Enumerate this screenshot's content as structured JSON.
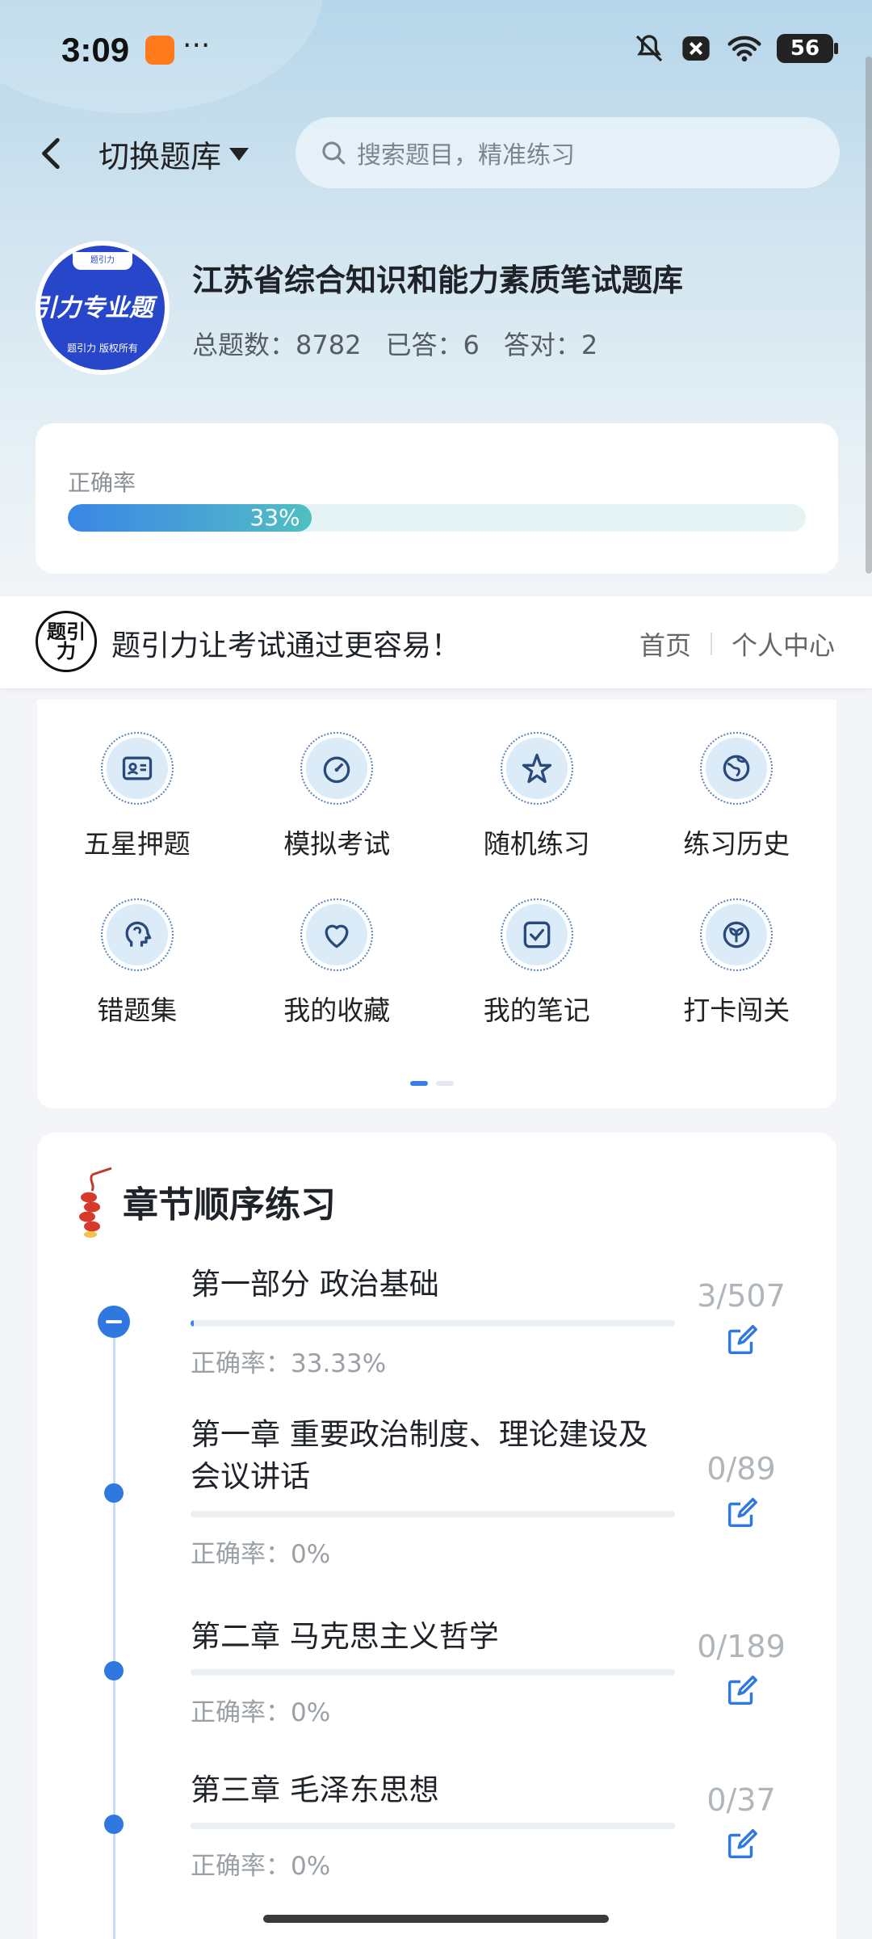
{
  "status_bar": {
    "time": "3:09",
    "dots": "···",
    "battery": "56"
  },
  "header": {
    "switch_label": "切换题库",
    "search_placeholder": "搜索题目，精准练习"
  },
  "bank": {
    "logo_top": "题引力",
    "logo_main": "引力专业题",
    "logo_bottom": "题引力 版权所有",
    "title": "江苏省综合知识和能力素质笔试题库",
    "total_label": "总题数：8782",
    "answered_label": "已答：6",
    "correct_label": "答对：2"
  },
  "accuracy": {
    "label": "正确率",
    "percent_text": "33%",
    "percent": 33
  },
  "banner": {
    "logo_text": "题引力",
    "slogan": "题引力让考试通过更容易！",
    "nav_home": "首页",
    "nav_personal": "个人中心"
  },
  "features": [
    {
      "label": "五星押题",
      "icon": "id-card-icon"
    },
    {
      "label": "模拟考试",
      "icon": "gauge-icon"
    },
    {
      "label": "随机练习",
      "icon": "compass-star-icon"
    },
    {
      "label": "练习历史",
      "icon": "globe-icon"
    },
    {
      "label": "错题集",
      "icon": "head-icon"
    },
    {
      "label": "我的收藏",
      "icon": "heart-icon"
    },
    {
      "label": "我的笔记",
      "icon": "checkbox-icon"
    },
    {
      "label": "打卡闯关",
      "icon": "leaf-icon"
    }
  ],
  "chapter_section": {
    "title": "章节顺序练习"
  },
  "chapters": [
    {
      "name": "第一部分 政治基础",
      "rate": "正确率：33.33%",
      "count": "3/507",
      "progress": 0.006
    },
    {
      "name": "第一章 重要政治制度、理论建设及会议讲话",
      "rate": "正确率：0%",
      "count": "0/89",
      "progress": 0
    },
    {
      "name": "第二章 马克思主义哲学",
      "rate": "正确率：0%",
      "count": "0/189",
      "progress": 0
    },
    {
      "name": "第三章 毛泽东思想",
      "rate": "正确率：0%",
      "count": "0/37",
      "progress": 0
    }
  ],
  "colors": {
    "accent": "#2f78e0",
    "logo_blue": "#2846c9"
  }
}
